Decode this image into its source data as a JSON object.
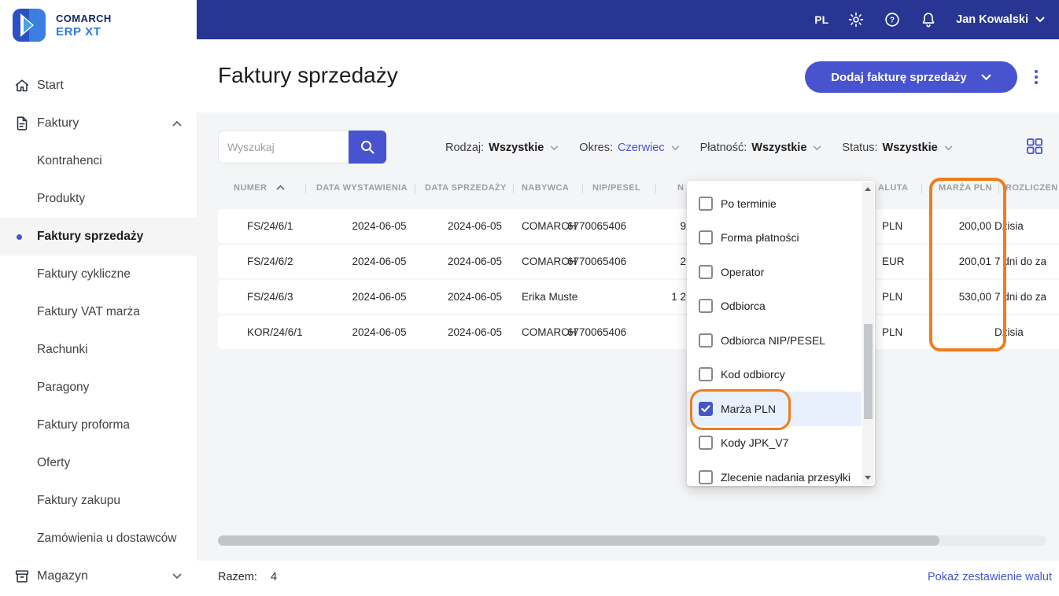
{
  "topbar": {
    "language": "PL",
    "user_name": "Jan Kowalski"
  },
  "sidebar": {
    "brand_line1": "COMARCH",
    "brand_line2": "ERP XT",
    "items": [
      {
        "label": "Start"
      },
      {
        "label": "Faktury"
      },
      {
        "label": "Kontrahenci"
      },
      {
        "label": "Produkty"
      },
      {
        "label": "Faktury sprzedaży"
      },
      {
        "label": "Faktury cykliczne"
      },
      {
        "label": "Faktury VAT marża"
      },
      {
        "label": "Rachunki"
      },
      {
        "label": "Paragony"
      },
      {
        "label": "Faktury proforma"
      },
      {
        "label": "Oferty"
      },
      {
        "label": "Faktury zakupu"
      },
      {
        "label": "Zamówienia u dostawców"
      },
      {
        "label": "Magazyn"
      }
    ]
  },
  "header": {
    "title": "Faktury sprzedaży",
    "add_button_label": "Dodaj fakturę sprzedaży"
  },
  "filters": {
    "search_placeholder": "Wyszukaj",
    "rodzaj_label": "Rodzaj:",
    "rodzaj_value": "Wszystkie",
    "okres_label": "Okres:",
    "okres_value": "Czerwiec",
    "platnosc_label": "Płatność:",
    "platnosc_value": "Wszystkie",
    "status_label": "Status:",
    "status_value": "Wszystkie"
  },
  "table": {
    "headers": {
      "numer": "NUMER",
      "data_wystawienia": "DATA WYSTAWIENIA",
      "data_sprzedazy": "DATA SPRZEDAŻY",
      "nabywca": "NABYWCA",
      "nip_pesel": "NIP/PESEL",
      "netto_fragment": "N",
      "waluta_fragment": "ALUTA",
      "marza_pln": "MARŻA PLN",
      "rozliczenie_fragment": "ROZLICZEN"
    },
    "rows": [
      {
        "numer": "FS/24/6/1",
        "data_wystawienia": "2024-06-05",
        "data_sprzedazy": "2024-06-05",
        "nabywca": "COMARCH",
        "nip_pesel": "6770065406",
        "netto_fragment": "9",
        "waluta": "PLN",
        "marza_pln": "200,00",
        "rozliczenie_fragment": "Dzisia"
      },
      {
        "numer": "FS/24/6/2",
        "data_wystawienia": "2024-06-05",
        "data_sprzedazy": "2024-06-05",
        "nabywca": "COMARCH",
        "nip_pesel": "6770065406",
        "netto_fragment": "2",
        "waluta": "EUR",
        "marza_pln": "200,01",
        "rozliczenie_fragment": "7 dni do za"
      },
      {
        "numer": "FS/24/6/3",
        "data_wystawienia": "2024-06-05",
        "data_sprzedazy": "2024-06-05",
        "nabywca": "Erika Muste",
        "nip_pesel": "",
        "netto_fragment": "1 2",
        "waluta": "PLN",
        "marza_pln": "530,00",
        "rozliczenie_fragment": "7 dni do za"
      },
      {
        "numer": "KOR/24/6/1",
        "data_wystawienia": "2024-06-05",
        "data_sprzedazy": "2024-06-05",
        "nabywca": "COMARCH",
        "nip_pesel": "6770065406",
        "netto_fragment": "",
        "waluta": "PLN",
        "marza_pln": "",
        "rozliczenie_fragment": "Dzisia"
      }
    ]
  },
  "column_dropdown": {
    "items": [
      {
        "label": "Po terminie",
        "checked": false
      },
      {
        "label": "Forma płatności",
        "checked": false
      },
      {
        "label": "Operator",
        "checked": false
      },
      {
        "label": "Odbiorca",
        "checked": false
      },
      {
        "label": "Odbiorca NIP/PESEL",
        "checked": false
      },
      {
        "label": "Kod odbiorcy",
        "checked": false
      },
      {
        "label": "Marża PLN",
        "checked": true
      },
      {
        "label": "Kody JPK_V7",
        "checked": false
      },
      {
        "label": "Zlecenie nadania przesyłki",
        "checked": false
      }
    ]
  },
  "footer": {
    "total_label": "Razem:",
    "total_value": "4",
    "currencies_link": "Pokaż zestawienie walut"
  },
  "colors": {
    "topbar": "#283593",
    "accent": "#4753cf",
    "highlight_orange": "#ee7d1d",
    "status_green": "#3fc3a0"
  }
}
